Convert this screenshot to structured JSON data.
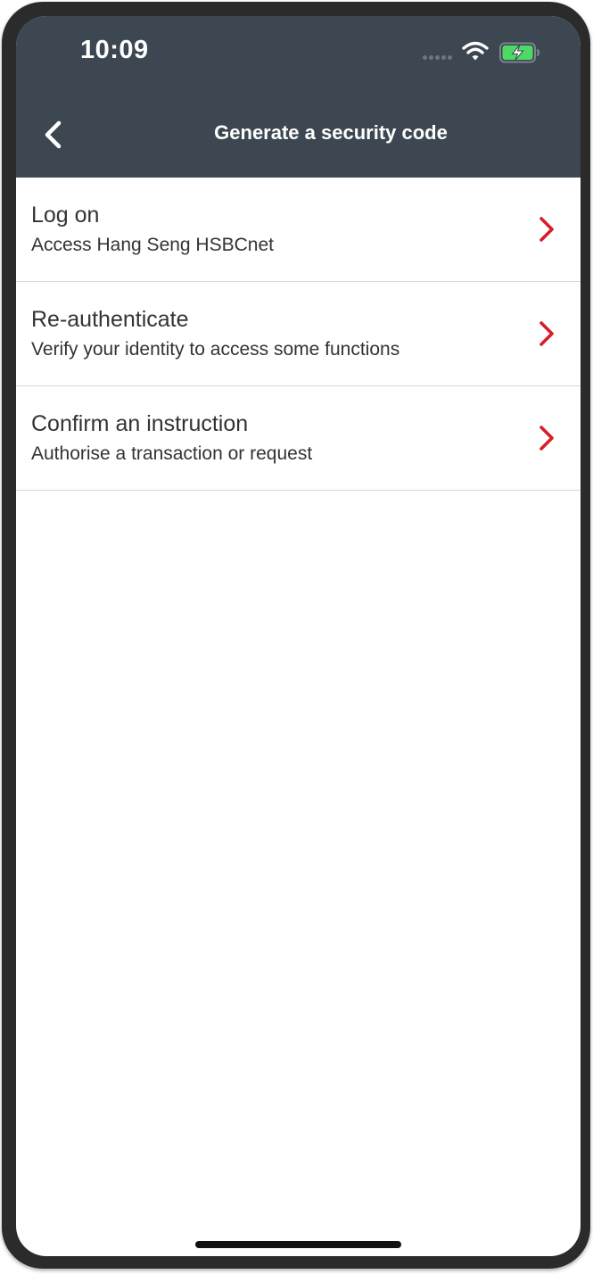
{
  "status_bar": {
    "time": "10:09"
  },
  "header": {
    "title": "Generate a security code",
    "back_icon": "chevron-left-icon"
  },
  "options": [
    {
      "title": "Log on",
      "subtitle": "Access Hang Seng HSBCnet"
    },
    {
      "title": "Re-authenticate",
      "subtitle": "Verify your identity to access some functions"
    },
    {
      "title": "Confirm an instruction",
      "subtitle": "Authorise a transaction or request"
    }
  ],
  "colors": {
    "header_bg": "#3d4751",
    "chevron": "#d71e28",
    "battery_fill": "#4cd964",
    "text": "#333333",
    "divider": "#d9d9d9"
  }
}
